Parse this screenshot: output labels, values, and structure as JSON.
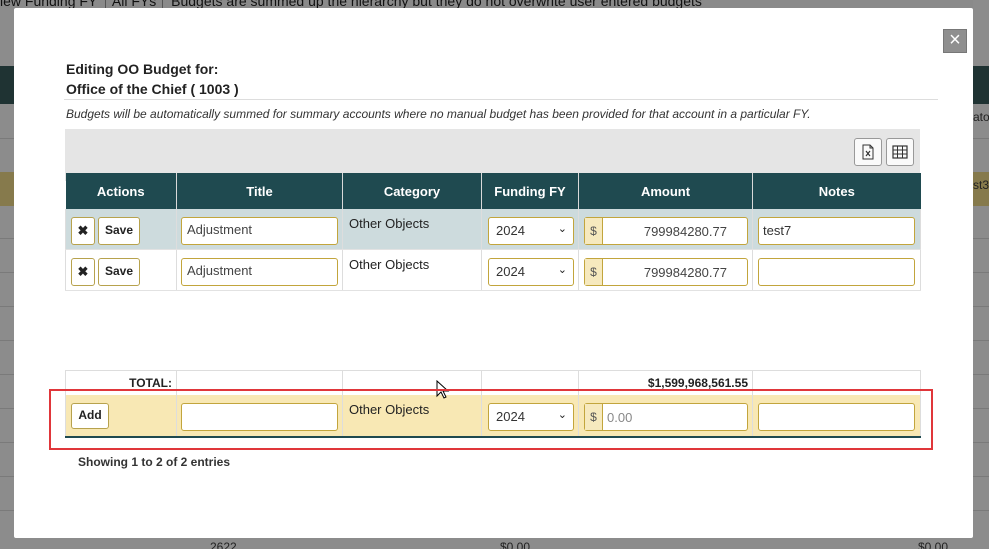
{
  "background": {
    "top_text": "iew   Funding FY",
    "top_select": "All FYs",
    "top_note": "Budgets are summed up the hierarchy but they do not overwrite user entered budgets",
    "right_texts": [
      "ato-",
      "st3"
    ],
    "bottom_values": [
      "2622",
      "$0.00",
      "$0.00"
    ]
  },
  "modal": {
    "title_line1": "Editing OO Budget for:",
    "title_line2": "Office of the Chief ( 1003 )",
    "note": "Budgets will be automatically summed for summary accounts where no manual budget has been provided for that account in a particular FY.",
    "close_glyph": "×",
    "toolbar": {
      "excel_icon": "excel-export-icon",
      "columns_icon": "table-columns-icon"
    },
    "columns": [
      "Actions",
      "Title",
      "Category",
      "Funding FY",
      "Amount",
      "Notes"
    ],
    "rows": [
      {
        "delete_glyph": "✖",
        "save_label": "Save",
        "title": "Adjustment",
        "category": "Other Objects",
        "funding_fy": "2024",
        "currency": "$",
        "amount": "799984280.77",
        "notes": "test7"
      },
      {
        "delete_glyph": "✖",
        "save_label": "Save",
        "title": "Adjustment",
        "category": "Other Objects",
        "funding_fy": "2024",
        "currency": "$",
        "amount": "799984280.77",
        "notes": ""
      }
    ],
    "total_label": "TOTAL:",
    "total_amount": "$1,599,968,561.55",
    "add_row": {
      "add_label": "Add",
      "title": "",
      "category": "Other Objects",
      "funding_fy": "2024",
      "currency": "$",
      "amount_placeholder": "0.00",
      "notes": ""
    },
    "showing_text": "Showing 1 to 2 of 2 entries"
  }
}
